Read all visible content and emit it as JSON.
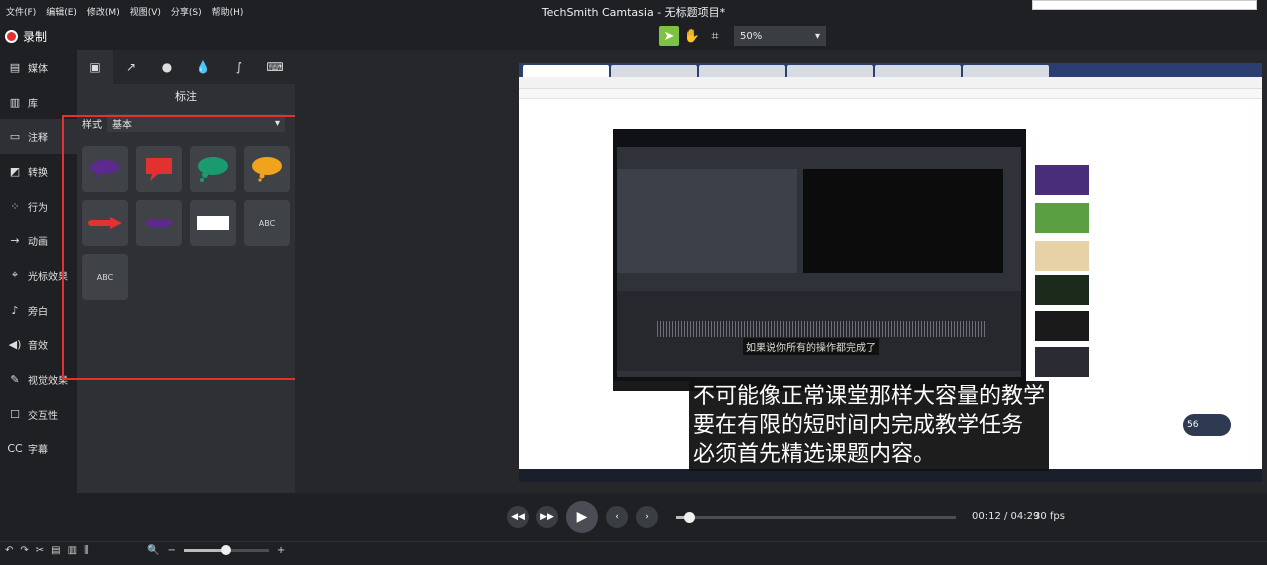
{
  "app": {
    "title": "TechSmith Camtasia - 无标题项目*",
    "menus": [
      "文件(F)",
      "编辑(E)",
      "修改(M)",
      "视图(V)",
      "分享(S)",
      "帮助(H)"
    ]
  },
  "record": {
    "label": "录制"
  },
  "canvas_toolbar": {
    "zoom": "50%"
  },
  "sidebar": {
    "items": [
      {
        "label": "媒体",
        "icon": "media-icon"
      },
      {
        "label": "库",
        "icon": "library-icon"
      },
      {
        "label": "注释",
        "icon": "annotation-icon"
      },
      {
        "label": "转换",
        "icon": "transition-icon"
      },
      {
        "label": "行为",
        "icon": "behavior-icon"
      },
      {
        "label": "动画",
        "icon": "animation-icon"
      },
      {
        "label": "光标效果",
        "icon": "cursor-effect-icon"
      },
      {
        "label": "旁白",
        "icon": "microphone-icon"
      },
      {
        "label": "音效",
        "icon": "audio-effect-icon"
      },
      {
        "label": "视觉效果",
        "icon": "visual-effect-icon"
      },
      {
        "label": "交互性",
        "icon": "interactivity-icon"
      },
      {
        "label": "字幕",
        "icon": "captions-icon"
      }
    ],
    "active_index": 2
  },
  "panel": {
    "title": "标注",
    "style_label": "样式",
    "style_value": "基本",
    "annotation_text": "ABC"
  },
  "canvas_caption": {
    "lines": [
      "不可能像正常课堂那样大容量的教学",
      "要在有限的短时间内完成教学任务",
      "必须首先精选课题内容。"
    ]
  },
  "inner_video": {
    "caption": "如果说你所有的操作都完成了"
  },
  "playback": {
    "time": "00:12 / 04:29",
    "fps": "30 fps",
    "progress": 0.045
  },
  "timeline": {
    "zoom_level": 0.5
  },
  "badge": {
    "value": "56"
  },
  "colors": {
    "accent": "#7dc242",
    "record": "#e2312f",
    "highlight_box": "#e2312f"
  }
}
